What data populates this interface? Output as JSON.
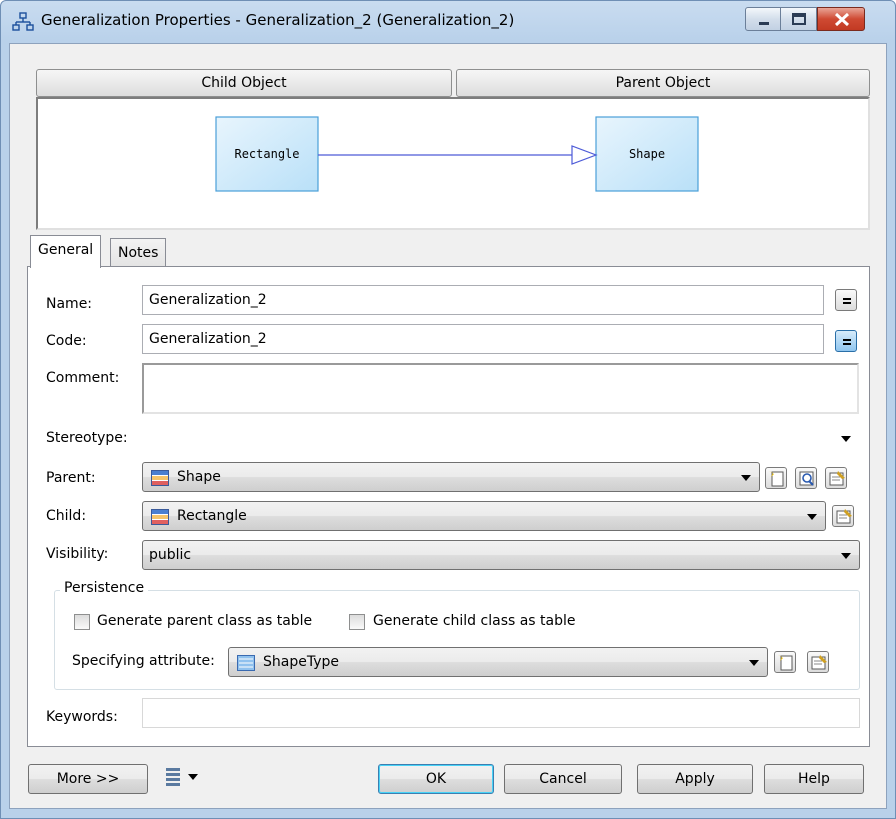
{
  "window": {
    "title": "Generalization Properties - Generalization_2 (Generalization_2)"
  },
  "header": {
    "child_label": "Child Object",
    "parent_label": "Parent Object"
  },
  "diagram": {
    "child_name": "Rectangle",
    "parent_name": "Shape"
  },
  "tabs": [
    {
      "label": "General",
      "active": true
    },
    {
      "label": "Notes",
      "active": false
    }
  ],
  "form": {
    "name_label": "Name:",
    "name_value": "Generalization_2",
    "code_label": "Code:",
    "code_value": "Generalization_2",
    "comment_label": "Comment:",
    "comment_value": "",
    "stereotype_label": "Stereotype:",
    "stereotype_value": "",
    "parent_label": "Parent:",
    "parent_value": "Shape",
    "child_label": "Child:",
    "child_value": "Rectangle",
    "visibility_label": "Visibility:",
    "visibility_value": "public",
    "persistence_title": "Persistence",
    "gen_parent_label": "Generate parent class as table",
    "gen_child_label": "Generate child class as table",
    "specifying_label": "Specifying attribute:",
    "specifying_value": "ShapeType",
    "keywords_label": "Keywords:",
    "keywords_value": ""
  },
  "footer": {
    "more_label": "More >>",
    "ok_label": "OK",
    "cancel_label": "Cancel",
    "apply_label": "Apply",
    "help_label": "Help"
  },
  "colors": {
    "diagram_box_fill": "#cfe9fb",
    "diagram_box_border": "#4a9fd8",
    "diagram_link": "#4d5bd8"
  }
}
